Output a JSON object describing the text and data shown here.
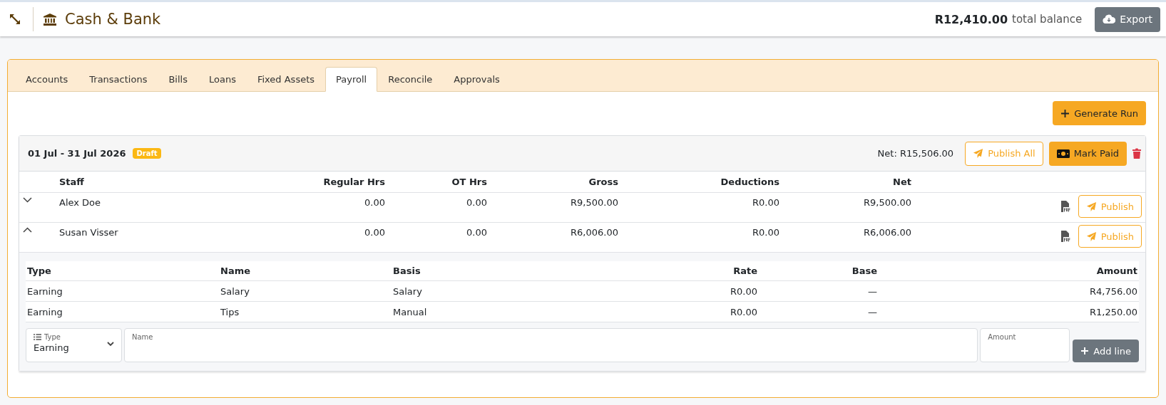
{
  "header": {
    "title": "Cash & Bank",
    "total": "R12,410.00",
    "total_label": "total balance",
    "export_button": "Export"
  },
  "tabs": [
    {
      "label": "Accounts",
      "selected": false
    },
    {
      "label": "Transactions",
      "selected": false
    },
    {
      "label": "Bills",
      "selected": false
    },
    {
      "label": "Loans",
      "selected": false
    },
    {
      "label": "Fixed Assets",
      "selected": false
    },
    {
      "label": "Payroll",
      "selected": true
    },
    {
      "label": "Reconcile",
      "selected": false
    },
    {
      "label": "Approvals",
      "selected": false
    }
  ],
  "generate_button": "Generate Run",
  "run": {
    "period": "01 Jul - 31 Jul 2026",
    "status": "Draft",
    "net": "Net: R15,506.00",
    "publish_all_button": "Publish All",
    "mark_paid_button": "Mark Paid",
    "columns": [
      "Staff",
      "Regular Hrs",
      "OT Hrs",
      "Gross",
      "Deductions",
      "Net"
    ],
    "rows": [
      {
        "staff": "Alex Doe",
        "regular_hrs": "0.00",
        "ot_hrs": "0.00",
        "gross": "R9,500.00",
        "deductions": "R0.00",
        "net": "R9,500.00",
        "publish_button": "Publish",
        "expanded": false
      },
      {
        "staff": "Susan Visser",
        "regular_hrs": "0.00",
        "ot_hrs": "0.00",
        "gross": "R6,006.00",
        "deductions": "R0.00",
        "net": "R6,006.00",
        "publish_button": "Publish",
        "expanded": true,
        "detail": {
          "columns": [
            "Type",
            "Name",
            "Basis",
            "Rate",
            "Base",
            "Amount"
          ],
          "lines": [
            {
              "type": "Earning",
              "name": "Salary",
              "basis": "Salary",
              "rate": "R0.00",
              "base": "—",
              "amount": "R4,756.00"
            },
            {
              "type": "Earning",
              "name": "Tips",
              "basis": "Manual",
              "rate": "R0.00",
              "base": "—",
              "amount": "R1,250.00"
            }
          ],
          "form": {
            "type_label": "Type",
            "type_value": "Earning",
            "name_label": "Name",
            "amount_label": "Amount",
            "add_button": "Add line"
          }
        }
      }
    ]
  }
}
